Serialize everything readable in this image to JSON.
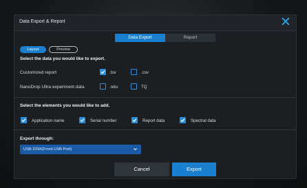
{
  "dialog": {
    "title": "Data Export & Report",
    "close_icon": "close-icon"
  },
  "tabs": [
    {
      "label": "Data Export",
      "active": true
    },
    {
      "label": "Report",
      "active": false
    }
  ],
  "view_toggle": [
    {
      "label": "Layout",
      "active": true
    },
    {
      "label": "Preview",
      "active": false
    }
  ],
  "data_section": {
    "heading": "Select the data you would like to export.",
    "rows": [
      {
        "label": "Customized report",
        "options": [
          {
            "label": ".tsv",
            "checked": true
          },
          {
            "label": ".csv",
            "checked": false
          }
        ]
      },
      {
        "label": "NanoDrop Ultra experiment data",
        "options": [
          {
            "label": ".ndu",
            "checked": false
          },
          {
            "label": "TQ",
            "checked": false
          }
        ]
      }
    ]
  },
  "elements_section": {
    "heading": "Select the elements you would like to add.",
    "options": [
      {
        "label": "Application name",
        "checked": true
      },
      {
        "label": "Serial number",
        "checked": true
      },
      {
        "label": "Report data",
        "checked": true
      },
      {
        "label": "Spectral data",
        "checked": true
      }
    ]
  },
  "export_through": {
    "heading": "Export through:",
    "selected": "USB DISK(Front USB Port)"
  },
  "buttons": {
    "cancel": "Cancel",
    "export": "Export"
  },
  "colors": {
    "accent": "#1b7fd0",
    "checkbox": "#2b8fe0",
    "close": "#2aa3f2",
    "background": "#1c1f22"
  }
}
